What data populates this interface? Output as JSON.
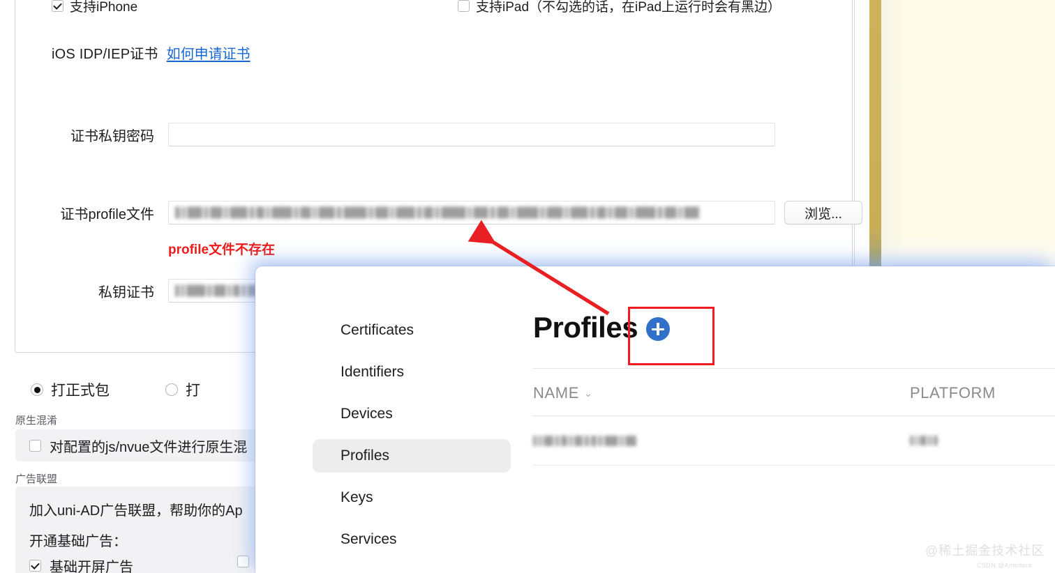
{
  "settings_panel": {
    "support_iphone": {
      "label": "支持iPhone",
      "checked": true
    },
    "support_ipad": {
      "label": "支持iPad（不勾选的话，在iPad上运行时会有黑边）",
      "checked": false
    },
    "idp_section": {
      "label": "iOS IDP/IEP证书",
      "link": "如何申请证书"
    },
    "fields": [
      {
        "label": "证书私钥密码",
        "value": "",
        "redacted": false
      },
      {
        "label": "证书profile文件",
        "value": "",
        "redacted": true
      },
      {
        "label": "私钥证书",
        "value": "",
        "redacted": true
      }
    ],
    "browse_button": "浏览...",
    "error_message": "profile文件不存在"
  },
  "build_options": {
    "release": {
      "label": "打正式包",
      "selected": true
    },
    "other": {
      "label": "打",
      "selected": false
    }
  },
  "obfuscation": {
    "section_title": "原生混淆",
    "item": {
      "label": "对配置的js/nvue文件进行原生混",
      "checked": false
    }
  },
  "ad_alliance": {
    "section_title": "广告联盟",
    "intro": "加入uni-AD广告联盟，帮助你的Ap",
    "subtitle": "开通基础广告：",
    "item": {
      "label": "基础开屏广告",
      "checked": true
    }
  },
  "developer_dialog": {
    "nav": [
      {
        "label": "Certificates",
        "active": false
      },
      {
        "label": "Identifiers",
        "active": false
      },
      {
        "label": "Devices",
        "active": false
      },
      {
        "label": "Profiles",
        "active": true
      },
      {
        "label": "Keys",
        "active": false
      },
      {
        "label": "Services",
        "active": false
      }
    ],
    "page_title": "Profiles",
    "add_button": "+",
    "table": {
      "columns": [
        "NAME",
        "PLATFORM"
      ],
      "sort_indicator": "⌄",
      "rows": [
        {
          "name": "",
          "platform": "",
          "redacted": true
        }
      ]
    }
  },
  "annotations": {
    "rect_color": "#f01c21",
    "arrow_color": "#e81f23"
  },
  "watermark": {
    "primary": "@稀土掘金技术社区",
    "secondary": "CSDN @Amodoro"
  },
  "colors": {
    "accent_blue": "#3070c9",
    "link_blue": "#1667d6",
    "error_red": "#ec1c1c",
    "gold_bar": "#cdb25b",
    "cream_panel": "#fdfae8"
  }
}
